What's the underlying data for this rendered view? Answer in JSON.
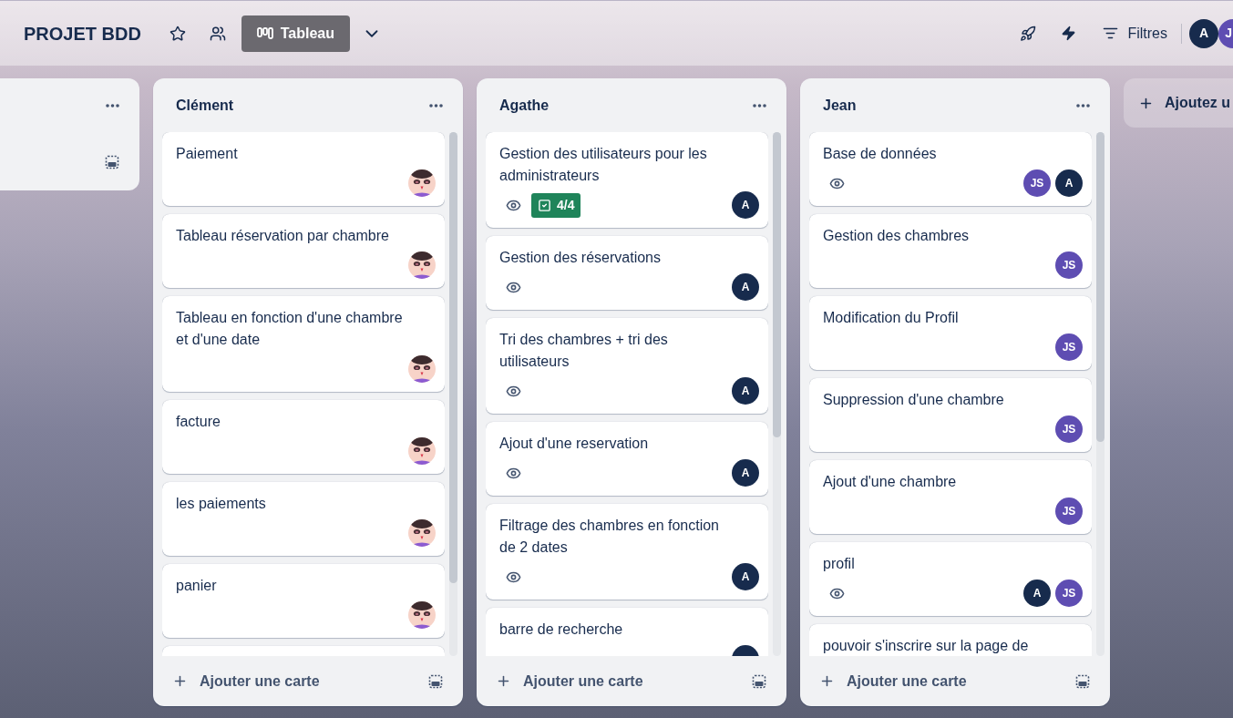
{
  "header": {
    "title": "PROJET BDD",
    "view_button": "Tableau",
    "filter_button": "Filtres",
    "members": [
      {
        "kind": "full",
        "initials": "A",
        "color": "#172b4d"
      },
      {
        "kind": "clipped",
        "initials": "J",
        "color": "#5e4db2"
      }
    ]
  },
  "lists": [
    {
      "kind": "clipped"
    },
    {
      "kind": "full",
      "title": "Clément",
      "add_card": "Ajouter une carte",
      "cards": [
        {
          "kind": "task",
          "title": "Paiement",
          "watching": false,
          "members": [
            {
              "kind": "picture"
            }
          ]
        },
        {
          "kind": "task",
          "title": "Tableau réservation par chambre",
          "watching": false,
          "members": [
            {
              "kind": "picture"
            }
          ]
        },
        {
          "kind": "task",
          "title": "Tableau en fonction d'une chambre et d'une date",
          "watching": false,
          "members": [
            {
              "kind": "picture"
            }
          ]
        },
        {
          "kind": "task",
          "title": "facture",
          "watching": false,
          "members": [
            {
              "kind": "picture"
            }
          ]
        },
        {
          "kind": "task",
          "title": "les paiements",
          "watching": false,
          "members": [
            {
              "kind": "picture"
            }
          ]
        },
        {
          "kind": "task",
          "title": "panier",
          "watching": false,
          "members": [
            {
              "kind": "picture"
            }
          ]
        },
        {
          "kind": "blank"
        }
      ]
    },
    {
      "kind": "full",
      "title": "Agathe",
      "add_card": "Ajouter une carte",
      "cards": [
        {
          "kind": "task",
          "title": "Gestion des utilisateurs pour les administrateurs",
          "watching": true,
          "checklist": {
            "text": "4/4",
            "complete": true
          },
          "members": [
            {
              "kind": "initials",
              "initials": "A",
              "color": "#172b4d"
            }
          ]
        },
        {
          "kind": "task",
          "title": "Gestion des réservations",
          "watching": true,
          "members": [
            {
              "kind": "initials",
              "initials": "A",
              "color": "#172b4d"
            }
          ]
        },
        {
          "kind": "task",
          "title": "Tri des chambres + tri des utilisateurs",
          "watching": true,
          "members": [
            {
              "kind": "initials",
              "initials": "A",
              "color": "#172b4d"
            }
          ]
        },
        {
          "kind": "task",
          "title": "Ajout d'une reservation",
          "watching": true,
          "members": [
            {
              "kind": "initials",
              "initials": "A",
              "color": "#172b4d"
            }
          ]
        },
        {
          "kind": "task",
          "title": "Filtrage des chambres en fonction de 2 dates",
          "watching": true,
          "members": [
            {
              "kind": "initials",
              "initials": "A",
              "color": "#172b4d"
            }
          ]
        },
        {
          "kind": "task",
          "title": "barre de recherche",
          "members": [
            {
              "kind": "initials",
              "color": "#172b4d"
            }
          ]
        }
      ]
    },
    {
      "kind": "full",
      "title": "Jean",
      "add_card": "Ajouter une carte",
      "cards": [
        {
          "kind": "task",
          "title": "Base de données",
          "watching": true,
          "members": [
            {
              "kind": "initials",
              "initials": "JS",
              "color": "#5e4db2"
            },
            {
              "kind": "initials",
              "initials": "A",
              "color": "#172b4d"
            }
          ]
        },
        {
          "kind": "task",
          "title": "Gestion des chambres",
          "watching": false,
          "members": [
            {
              "kind": "initials",
              "initials": "JS",
              "color": "#5e4db2"
            }
          ]
        },
        {
          "kind": "task",
          "title": "Modification du Profil",
          "watching": false,
          "members": [
            {
              "kind": "initials",
              "initials": "JS",
              "color": "#5e4db2"
            }
          ]
        },
        {
          "kind": "task",
          "title": "Suppression d'une chambre",
          "watching": false,
          "members": [
            {
              "kind": "initials",
              "initials": "JS",
              "color": "#5e4db2"
            }
          ]
        },
        {
          "kind": "task",
          "title": "Ajout d'une chambre",
          "watching": false,
          "members": [
            {
              "kind": "initials",
              "initials": "JS",
              "color": "#5e4db2"
            }
          ]
        },
        {
          "kind": "task",
          "title": "profil",
          "watching": true,
          "members": [
            {
              "kind": "initials",
              "initials": "A",
              "color": "#172b4d"
            },
            {
              "kind": "initials",
              "initials": "JS",
              "color": "#5e4db2"
            }
          ]
        },
        {
          "kind": "task",
          "title": "pouvoir s'inscrire sur la page de"
        }
      ]
    }
  ],
  "add_list_button": "Ajoutez u"
}
